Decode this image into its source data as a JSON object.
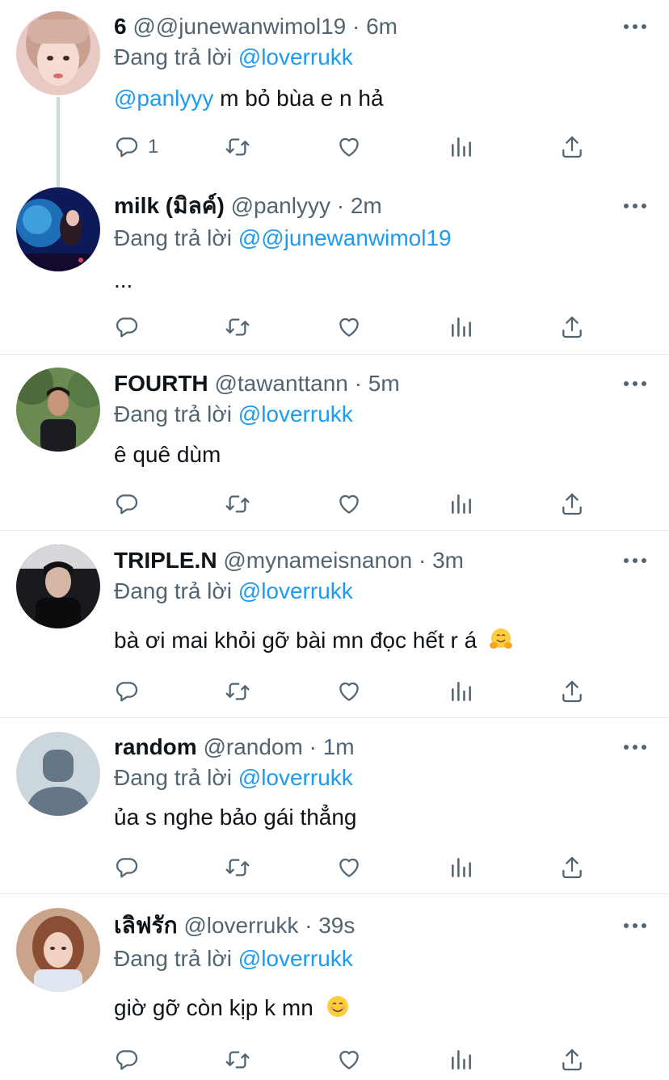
{
  "reply_prefix": "Đang trả lời",
  "tweets": [
    {
      "name": "6",
      "handle": "@@junewanwimol19",
      "sep": "·",
      "time": "6m",
      "reply_to": "@loverrukk",
      "mention": "@panlyyy",
      "text": "m bỏ bùa e n hả",
      "reply_count": "1"
    },
    {
      "name": "milk (มิลค์)",
      "handle": "@panlyyy",
      "sep": "·",
      "time": "2m",
      "reply_to": "@@junewanwimol19",
      "text": "..."
    },
    {
      "name": "FOURTH",
      "handle": "@tawanttann",
      "sep": "·",
      "time": "5m",
      "reply_to": "@loverrukk",
      "text": "ê quê dùm"
    },
    {
      "name": "TRIPLE.N",
      "handle": "@mynameisnanon",
      "sep": "·",
      "time": "3m",
      "reply_to": "@loverrukk",
      "text": "bà ơi mai khỏi gỡ bài mn đọc hết r á",
      "emoji": "hugging-face"
    },
    {
      "name": "random",
      "handle": "@random",
      "sep": "·",
      "time": "1m",
      "reply_to": "@loverrukk",
      "text": "ủa s nghe bảo gái thẳng"
    },
    {
      "name": "เลิฟรัก",
      "handle": "@loverrukk",
      "sep": "·",
      "time": "39s",
      "reply_to": "@loverrukk",
      "text": "giờ gỡ còn kịp k mn",
      "emoji": "smiling-face"
    }
  ],
  "colors": {
    "link": "#1d9bf0",
    "secondary": "#536471",
    "text": "#0f1419",
    "divider": "#e6e8ea"
  }
}
